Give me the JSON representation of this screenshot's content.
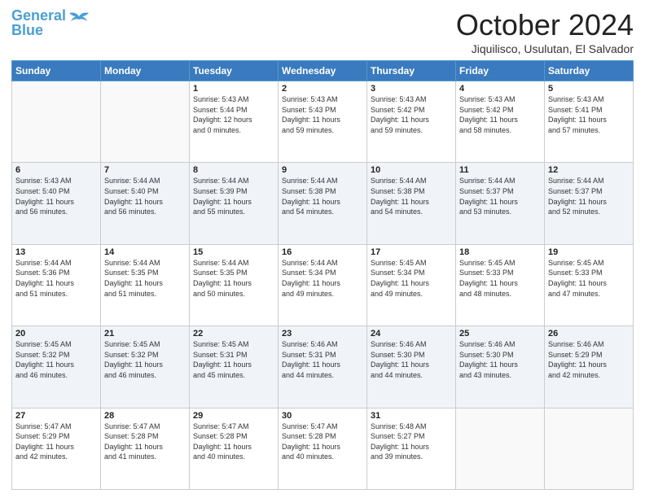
{
  "header": {
    "logo_line1": "General",
    "logo_line2": "Blue",
    "month_title": "October 2024",
    "location": "Jiquilisco, Usulutan, El Salvador"
  },
  "days_of_week": [
    "Sunday",
    "Monday",
    "Tuesday",
    "Wednesday",
    "Thursday",
    "Friday",
    "Saturday"
  ],
  "weeks": [
    [
      {
        "day": "",
        "info": ""
      },
      {
        "day": "",
        "info": ""
      },
      {
        "day": "1",
        "info": "Sunrise: 5:43 AM\nSunset: 5:44 PM\nDaylight: 12 hours\nand 0 minutes."
      },
      {
        "day": "2",
        "info": "Sunrise: 5:43 AM\nSunset: 5:43 PM\nDaylight: 11 hours\nand 59 minutes."
      },
      {
        "day": "3",
        "info": "Sunrise: 5:43 AM\nSunset: 5:42 PM\nDaylight: 11 hours\nand 59 minutes."
      },
      {
        "day": "4",
        "info": "Sunrise: 5:43 AM\nSunset: 5:42 PM\nDaylight: 11 hours\nand 58 minutes."
      },
      {
        "day": "5",
        "info": "Sunrise: 5:43 AM\nSunset: 5:41 PM\nDaylight: 11 hours\nand 57 minutes."
      }
    ],
    [
      {
        "day": "6",
        "info": "Sunrise: 5:43 AM\nSunset: 5:40 PM\nDaylight: 11 hours\nand 56 minutes."
      },
      {
        "day": "7",
        "info": "Sunrise: 5:44 AM\nSunset: 5:40 PM\nDaylight: 11 hours\nand 56 minutes."
      },
      {
        "day": "8",
        "info": "Sunrise: 5:44 AM\nSunset: 5:39 PM\nDaylight: 11 hours\nand 55 minutes."
      },
      {
        "day": "9",
        "info": "Sunrise: 5:44 AM\nSunset: 5:38 PM\nDaylight: 11 hours\nand 54 minutes."
      },
      {
        "day": "10",
        "info": "Sunrise: 5:44 AM\nSunset: 5:38 PM\nDaylight: 11 hours\nand 54 minutes."
      },
      {
        "day": "11",
        "info": "Sunrise: 5:44 AM\nSunset: 5:37 PM\nDaylight: 11 hours\nand 53 minutes."
      },
      {
        "day": "12",
        "info": "Sunrise: 5:44 AM\nSunset: 5:37 PM\nDaylight: 11 hours\nand 52 minutes."
      }
    ],
    [
      {
        "day": "13",
        "info": "Sunrise: 5:44 AM\nSunset: 5:36 PM\nDaylight: 11 hours\nand 51 minutes."
      },
      {
        "day": "14",
        "info": "Sunrise: 5:44 AM\nSunset: 5:35 PM\nDaylight: 11 hours\nand 51 minutes."
      },
      {
        "day": "15",
        "info": "Sunrise: 5:44 AM\nSunset: 5:35 PM\nDaylight: 11 hours\nand 50 minutes."
      },
      {
        "day": "16",
        "info": "Sunrise: 5:44 AM\nSunset: 5:34 PM\nDaylight: 11 hours\nand 49 minutes."
      },
      {
        "day": "17",
        "info": "Sunrise: 5:45 AM\nSunset: 5:34 PM\nDaylight: 11 hours\nand 49 minutes."
      },
      {
        "day": "18",
        "info": "Sunrise: 5:45 AM\nSunset: 5:33 PM\nDaylight: 11 hours\nand 48 minutes."
      },
      {
        "day": "19",
        "info": "Sunrise: 5:45 AM\nSunset: 5:33 PM\nDaylight: 11 hours\nand 47 minutes."
      }
    ],
    [
      {
        "day": "20",
        "info": "Sunrise: 5:45 AM\nSunset: 5:32 PM\nDaylight: 11 hours\nand 46 minutes."
      },
      {
        "day": "21",
        "info": "Sunrise: 5:45 AM\nSunset: 5:32 PM\nDaylight: 11 hours\nand 46 minutes."
      },
      {
        "day": "22",
        "info": "Sunrise: 5:45 AM\nSunset: 5:31 PM\nDaylight: 11 hours\nand 45 minutes."
      },
      {
        "day": "23",
        "info": "Sunrise: 5:46 AM\nSunset: 5:31 PM\nDaylight: 11 hours\nand 44 minutes."
      },
      {
        "day": "24",
        "info": "Sunrise: 5:46 AM\nSunset: 5:30 PM\nDaylight: 11 hours\nand 44 minutes."
      },
      {
        "day": "25",
        "info": "Sunrise: 5:46 AM\nSunset: 5:30 PM\nDaylight: 11 hours\nand 43 minutes."
      },
      {
        "day": "26",
        "info": "Sunrise: 5:46 AM\nSunset: 5:29 PM\nDaylight: 11 hours\nand 42 minutes."
      }
    ],
    [
      {
        "day": "27",
        "info": "Sunrise: 5:47 AM\nSunset: 5:29 PM\nDaylight: 11 hours\nand 42 minutes."
      },
      {
        "day": "28",
        "info": "Sunrise: 5:47 AM\nSunset: 5:28 PM\nDaylight: 11 hours\nand 41 minutes."
      },
      {
        "day": "29",
        "info": "Sunrise: 5:47 AM\nSunset: 5:28 PM\nDaylight: 11 hours\nand 40 minutes."
      },
      {
        "day": "30",
        "info": "Sunrise: 5:47 AM\nSunset: 5:28 PM\nDaylight: 11 hours\nand 40 minutes."
      },
      {
        "day": "31",
        "info": "Sunrise: 5:48 AM\nSunset: 5:27 PM\nDaylight: 11 hours\nand 39 minutes."
      },
      {
        "day": "",
        "info": ""
      },
      {
        "day": "",
        "info": ""
      }
    ]
  ]
}
